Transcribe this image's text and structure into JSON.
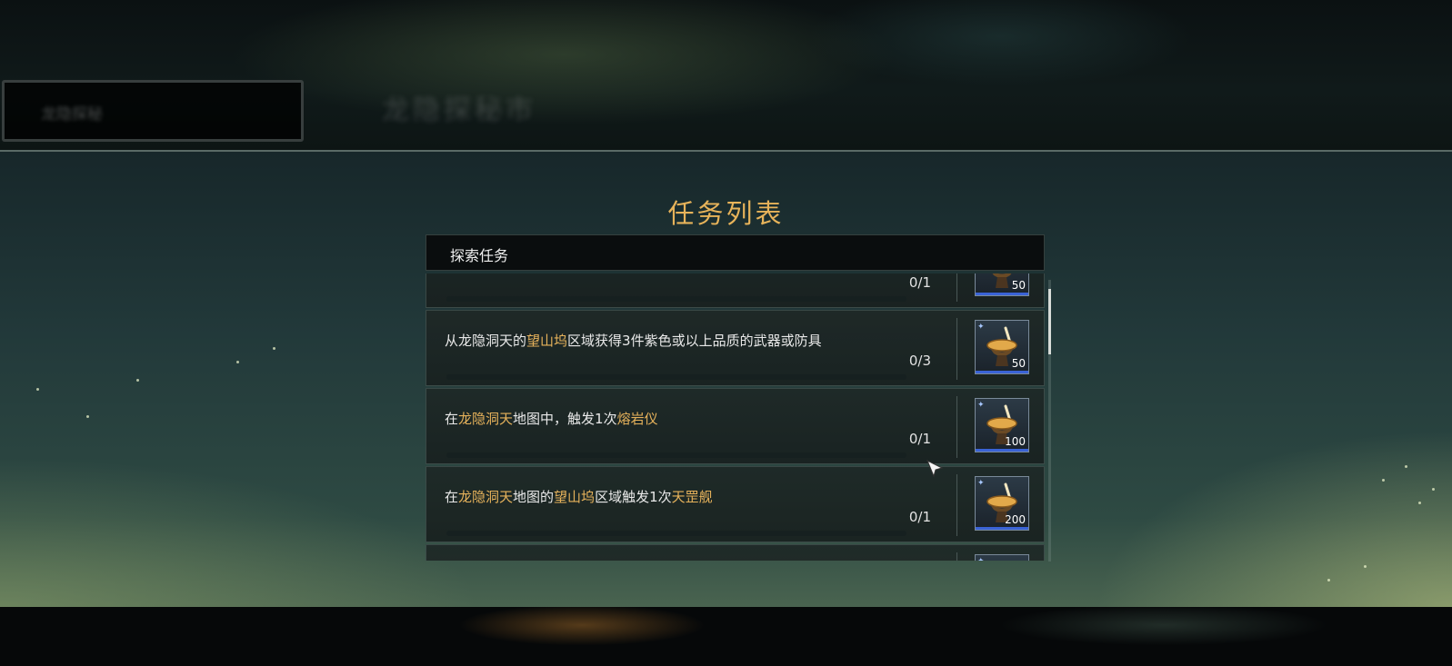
{
  "background": {
    "panel_label": "龙隐探秘",
    "title": "龙隐探秘市"
  },
  "modal": {
    "title": "任务列表",
    "section_title": "探索任务"
  },
  "tasks": [
    {
      "segments": [],
      "progress": "0/1",
      "reward_count": "50"
    },
    {
      "segments": [
        {
          "text": "从龙隐洞天的",
          "hl": false
        },
        {
          "text": "望山坞",
          "hl": true
        },
        {
          "text": "区域获得3件紫色或以上品质的武器或防具",
          "hl": false
        }
      ],
      "progress": "0/3",
      "reward_count": "50"
    },
    {
      "segments": [
        {
          "text": "在",
          "hl": false
        },
        {
          "text": "龙隐洞天",
          "hl": true
        },
        {
          "text": "地图中，触发1次",
          "hl": false
        },
        {
          "text": "熔岩仪",
          "hl": true
        }
      ],
      "progress": "0/1",
      "reward_count": "100"
    },
    {
      "segments": [
        {
          "text": "在",
          "hl": false
        },
        {
          "text": "龙隐洞天",
          "hl": true
        },
        {
          "text": "地图的",
          "hl": false
        },
        {
          "text": "望山坞",
          "hl": true
        },
        {
          "text": "区域触发1次",
          "hl": false
        },
        {
          "text": "天罡舰",
          "hl": true
        }
      ],
      "progress": "0/1",
      "reward_count": "200"
    },
    {
      "segments": [],
      "progress": "",
      "reward_count": ""
    }
  ],
  "colors": {
    "title": "#e7b35a",
    "highlight": "#e6b25b",
    "reward_underline": "#3a63d6"
  },
  "icons": {
    "reward": "cauldron-icon",
    "cursor": "arrow-cursor-icon"
  }
}
